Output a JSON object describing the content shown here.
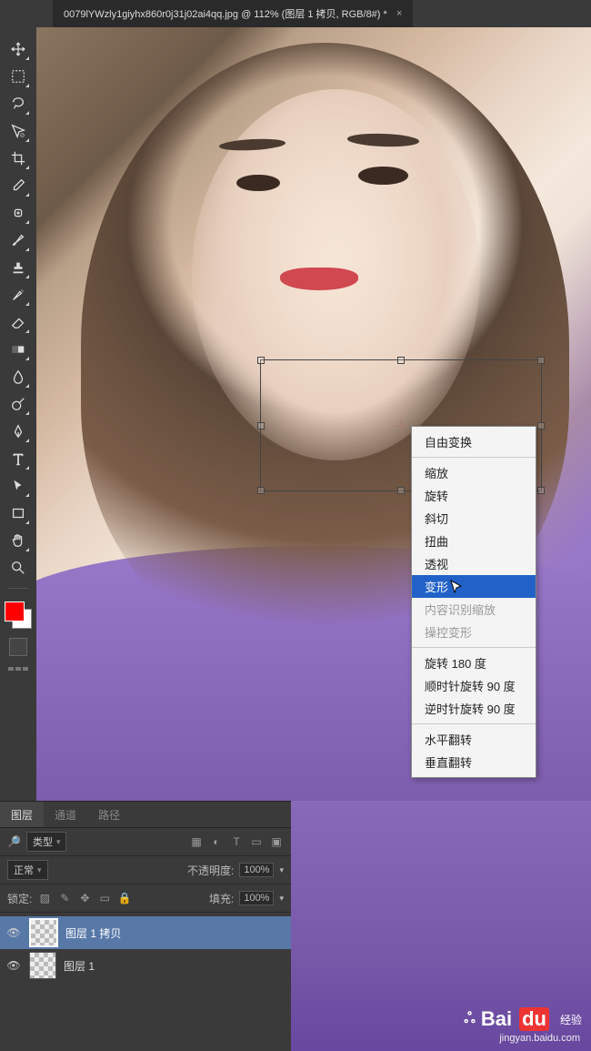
{
  "tab": {
    "title": "0079lYWzly1giyhx860r0j31j02ai4qq.jpg @ 112% (图层 1 拷贝, RGB/8#) *"
  },
  "transform_menu": {
    "groups": [
      [
        {
          "label": "自由变换",
          "highlight": false,
          "disabled": false
        }
      ],
      [
        {
          "label": "缩放",
          "highlight": false,
          "disabled": false
        },
        {
          "label": "旋转",
          "highlight": false,
          "disabled": false
        },
        {
          "label": "斜切",
          "highlight": false,
          "disabled": false
        },
        {
          "label": "扭曲",
          "highlight": false,
          "disabled": false
        },
        {
          "label": "透视",
          "highlight": false,
          "disabled": false
        },
        {
          "label": "变形",
          "highlight": true,
          "disabled": false
        },
        {
          "label": "内容识别缩放",
          "highlight": false,
          "disabled": true
        },
        {
          "label": "操控变形",
          "highlight": false,
          "disabled": true
        }
      ],
      [
        {
          "label": "旋转 180 度",
          "highlight": false,
          "disabled": false
        },
        {
          "label": "顺时针旋转 90 度",
          "highlight": false,
          "disabled": false
        },
        {
          "label": "逆时针旋转 90 度",
          "highlight": false,
          "disabled": false
        }
      ],
      [
        {
          "label": "水平翻转",
          "highlight": false,
          "disabled": false
        },
        {
          "label": "垂直翻转",
          "highlight": false,
          "disabled": false
        }
      ]
    ]
  },
  "panels": {
    "tabs": [
      "图层",
      "通道",
      "路径"
    ],
    "active_tab": 0,
    "filter_label": "类型",
    "blend_mode": "正常",
    "opacity_label": "不透明度:",
    "opacity_value": "100%",
    "lock_label": "锁定:",
    "fill_label": "填充:",
    "fill_value": "100%",
    "layers": [
      {
        "name": "图层 1 拷贝",
        "visible": true,
        "selected": true
      },
      {
        "name": "图层 1",
        "visible": true,
        "selected": false
      }
    ]
  },
  "watermark": {
    "brand": "Bai",
    "brand2": "du",
    "brand3": "经验",
    "url": "jingyan.baidu.com"
  },
  "colors": {
    "fg": "#ff0000",
    "bg": "#ffffff",
    "menu_hl": "#2262c8"
  }
}
